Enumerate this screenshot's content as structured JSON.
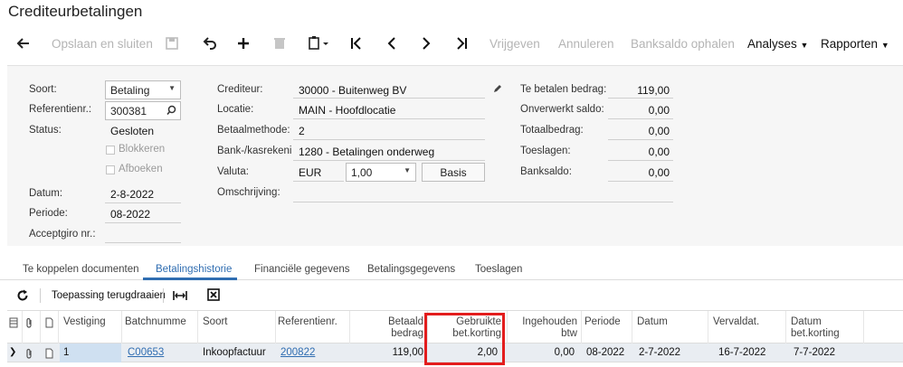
{
  "page": {
    "title": "Crediteurbetalingen"
  },
  "toolbar": {
    "save_close": "Opslaan en sluiten",
    "release": "Vrijgeven",
    "cancel": "Annuleren",
    "bank_balance": "Banksaldo ophalen",
    "analyses": "Analyses",
    "reports": "Rapporten"
  },
  "form": {
    "type": {
      "label": "Soort:",
      "value": "Betaling"
    },
    "reference": {
      "label": "Referentienr.:",
      "value": "300381"
    },
    "status": {
      "label": "Status:",
      "value": "Gesloten"
    },
    "block": {
      "label": "Blokkeren"
    },
    "void": {
      "label": "Afboeken"
    },
    "date": {
      "label": "Datum:",
      "value": "2-8-2022"
    },
    "period": {
      "label": "Periode:",
      "value": "08-2022"
    },
    "acceptgiro": {
      "label": "Acceptgiro nr.:",
      "value": ""
    },
    "vendor": {
      "label": "Crediteur:",
      "value": "30000 - Buitenweg BV"
    },
    "location": {
      "label": "Locatie:",
      "value": "MAIN - Hoofdlocatie"
    },
    "payment_method": {
      "label": "Betaalmethode:",
      "value": "2"
    },
    "cash_account": {
      "label": "Bank-/kasrekeni…",
      "value": "1280 - Betalingen onderweg"
    },
    "currency": {
      "label": "Valuta:",
      "code": "EUR",
      "rate": "1,00",
      "base_button": "Basis"
    },
    "description": {
      "label": "Omschrijving:",
      "value": ""
    },
    "amount_due": {
      "label": "Te betalen bedrag:",
      "value": "119,00"
    },
    "unapplied": {
      "label": "Onverwerkt saldo:",
      "value": "0,00"
    },
    "total": {
      "label": "Totaalbedrag:",
      "value": "0,00"
    },
    "charges": {
      "label": "Toeslagen:",
      "value": "0,00"
    },
    "bank_balance": {
      "label": "Banksaldo:",
      "value": "0,00"
    }
  },
  "tabs": [
    {
      "label": "Te koppelen documenten"
    },
    {
      "label": "Betalingshistorie"
    },
    {
      "label": "Financiële gegevens"
    },
    {
      "label": "Betalingsgegevens"
    },
    {
      "label": "Toeslagen"
    }
  ],
  "grid_toolbar": {
    "reverse": "Toepassing terugdraaien"
  },
  "grid": {
    "columns": {
      "branch": "Vestiging",
      "batch": "Batchnumme",
      "type": "Soort",
      "ref": "Referentienr.",
      "amount_1": "Betaald",
      "amount_2": "bedrag",
      "discount_1": "Gebruikte",
      "discount_2": "bet.korting",
      "vat_1": "Ingehouden",
      "vat_2": "btw",
      "period": "Periode",
      "date": "Datum",
      "due": "Vervaldat.",
      "discdate_1": "Datum",
      "discdate_2": "bet.korting"
    },
    "rows": [
      {
        "branch": "1",
        "batch": "C00653",
        "type": "Inkoopfactuur",
        "ref": "200822",
        "amount": "119,00",
        "discount": "2,00",
        "vat": "0,00",
        "period": "08-2022",
        "date": "2-7-2022",
        "due": "16-7-2022",
        "discdate": "7-7-2022"
      }
    ]
  }
}
